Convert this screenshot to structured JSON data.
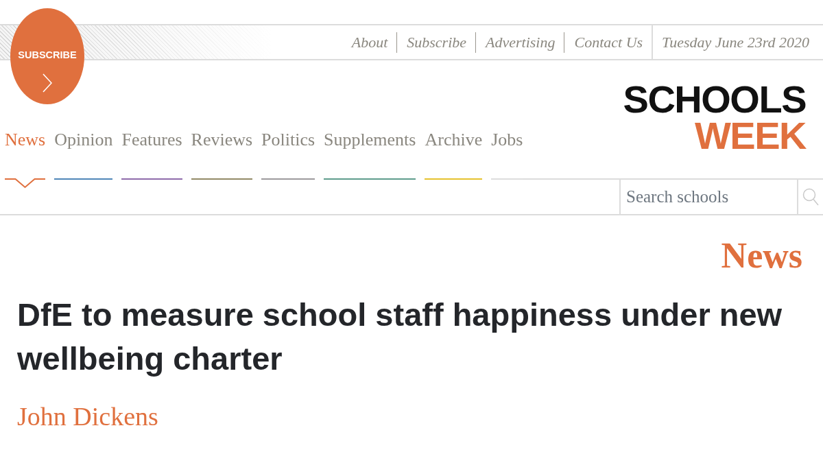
{
  "subscribe_badge": {
    "label": "SUBSCRIBE"
  },
  "top_links": [
    "About",
    "Subscribe",
    "Advertising",
    "Contact Us"
  ],
  "date": "Tuesday June 23rd 2020",
  "logo": {
    "line_1": "SCHOOLS",
    "line_2": "WEEK"
  },
  "nav": [
    {
      "label": "News",
      "color": "#e0703e",
      "selected": true
    },
    {
      "label": "Opinion",
      "color": "#4f86b8",
      "selected": false
    },
    {
      "label": "Features",
      "color": "#8f6bab",
      "selected": false
    },
    {
      "label": "Reviews",
      "color": "#928a66",
      "selected": false
    },
    {
      "label": "Politics",
      "color": "#9c9a9c",
      "selected": false
    },
    {
      "label": "Supplements",
      "color": "#5e9c8c",
      "selected": false
    },
    {
      "label": "Archive",
      "color": "#e6c22e",
      "selected": false
    },
    {
      "label": "Jobs",
      "color": "#dddddd",
      "selected": false
    }
  ],
  "search": {
    "placeholder": "Search schools"
  },
  "article": {
    "section": "News",
    "headline": "DfE to measure school staff happiness under new wellbeing charter",
    "author": "John Dickens"
  }
}
